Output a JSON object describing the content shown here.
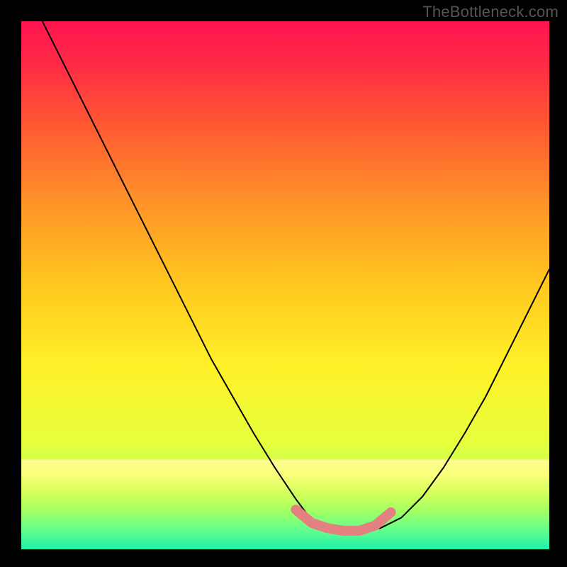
{
  "watermark": "TheBottleneck.com",
  "chart_data": {
    "type": "line",
    "title": "",
    "xlabel": "",
    "ylabel": "",
    "xlim": [
      0,
      100
    ],
    "ylim": [
      0,
      100
    ],
    "grid": false,
    "curve": {
      "x": [
        4,
        8,
        12,
        16,
        20,
        24,
        28,
        32,
        36,
        40,
        44,
        48,
        52,
        55,
        58,
        61,
        64,
        68,
        72,
        76,
        80,
        84,
        88,
        92,
        96,
        100
      ],
      "y": [
        100,
        92,
        84,
        76,
        68,
        60,
        52,
        44,
        36,
        29,
        22,
        15.5,
        9.5,
        5.5,
        4,
        3.5,
        3.5,
        4,
        6,
        10,
        15.5,
        22,
        29,
        37,
        45,
        53
      ]
    },
    "highlight_band": {
      "x": [
        52,
        55,
        58,
        61,
        64,
        67,
        70
      ],
      "y": [
        7.5,
        5,
        4,
        3.5,
        3.5,
        4.5,
        7
      ]
    },
    "background_gradient_stops": [
      {
        "offset": 0.0,
        "color": "#ff1450"
      },
      {
        "offset": 0.08,
        "color": "#ff2a46"
      },
      {
        "offset": 0.2,
        "color": "#ff5a32"
      },
      {
        "offset": 0.35,
        "color": "#ff9628"
      },
      {
        "offset": 0.5,
        "color": "#ffc81e"
      },
      {
        "offset": 0.65,
        "color": "#fff028"
      },
      {
        "offset": 0.8,
        "color": "#e6ff3c"
      },
      {
        "offset": 0.89,
        "color": "#b4ff64"
      },
      {
        "offset": 0.95,
        "color": "#6eff8c"
      },
      {
        "offset": 1.0,
        "color": "#1effb4"
      }
    ],
    "gradient_band_stops": [
      {
        "offset": 0.0,
        "color": "#fffb92"
      },
      {
        "offset": 0.18,
        "color": "#f8ff78"
      },
      {
        "offset": 0.38,
        "color": "#d2ff5a"
      },
      {
        "offset": 0.58,
        "color": "#a0ff64"
      },
      {
        "offset": 0.78,
        "color": "#64ff8c"
      },
      {
        "offset": 1.0,
        "color": "#1ef0aa"
      }
    ]
  }
}
